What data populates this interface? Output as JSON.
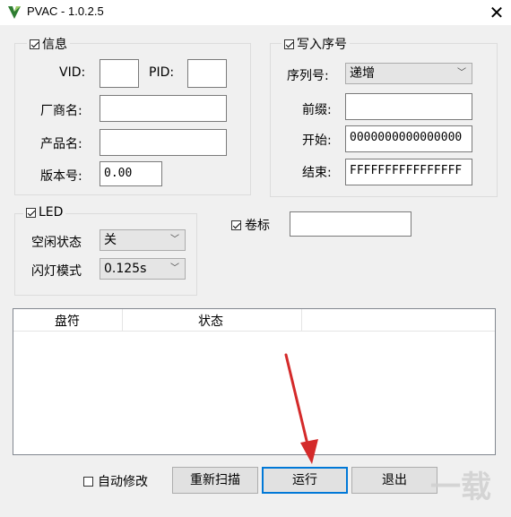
{
  "window": {
    "title": "PVAC - 1.0.2.5",
    "close_glyph": "✕"
  },
  "info_group": {
    "legend": "信息",
    "checked": true,
    "vid_label": "VID:",
    "vid_value": "",
    "pid_label": "PID:",
    "pid_value": "",
    "vendor_label": "厂商名:",
    "vendor_value": "",
    "product_label": "产品名:",
    "product_value": "",
    "version_label": "版本号:",
    "version_value": "0.00"
  },
  "serial_group": {
    "legend": "写入序号",
    "checked": true,
    "serial_label": "序列号:",
    "serial_mode": "递增",
    "prefix_label": "前缀:",
    "prefix_value": "",
    "start_label": "开始:",
    "start_value": "0000000000000000",
    "end_label": "结束:",
    "end_value": "FFFFFFFFFFFFFFFF"
  },
  "led_group": {
    "legend": "LED",
    "checked": true,
    "idle_label": "空闲状态",
    "idle_value": "关",
    "blink_label": "闪灯模式",
    "blink_value": "0.125s"
  },
  "volume": {
    "label": "卷标",
    "checked": true,
    "value": ""
  },
  "drive_list": {
    "columns": [
      "盘符",
      "状态"
    ],
    "rows": []
  },
  "bottom": {
    "auto_modify_label": "自动修改",
    "auto_modify_checked": false,
    "rescan_label": "重新扫描",
    "run_label": "运行",
    "exit_label": "退出"
  },
  "watermark": "一载",
  "colors": {
    "arrow": "#d42a2a",
    "focus_border": "#0078d7"
  }
}
